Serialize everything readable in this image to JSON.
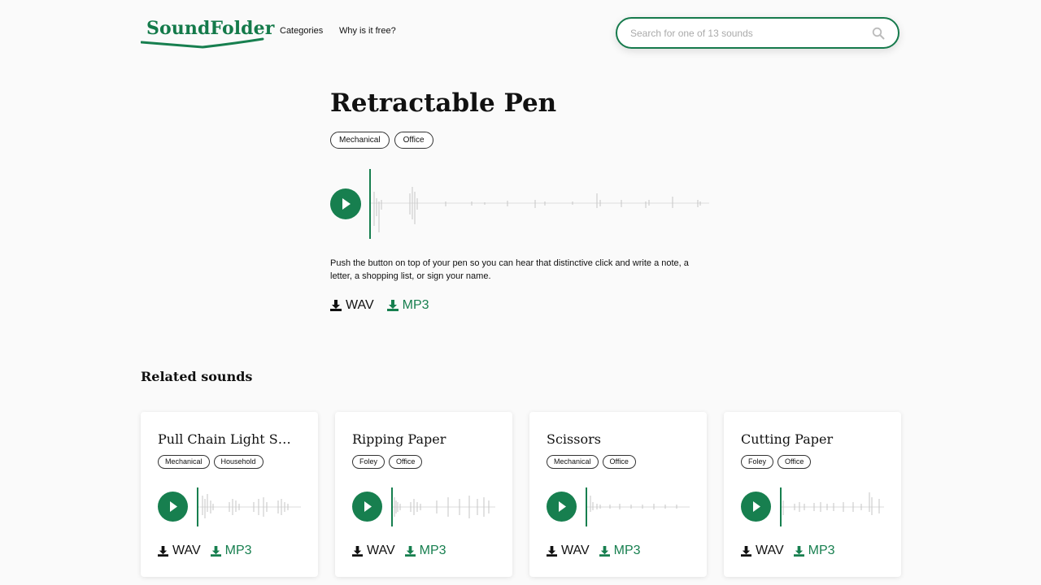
{
  "brand": {
    "name": "SoundFolder",
    "color": "#177f4f"
  },
  "nav": {
    "categories": "Categories",
    "why_free": "Why is it free?"
  },
  "search": {
    "placeholder": "Search for one of 13 sounds",
    "value": "",
    "icon": "search-icon"
  },
  "sound": {
    "title": "Retractable Pen",
    "tags": [
      "Mechanical",
      "Office"
    ],
    "description": "Push the button on top of your pen so you can hear that distinctive click and write a note, a letter, a shopping list, or sign your name.",
    "downloads": {
      "wav": "WAV",
      "mp3": "MP3"
    }
  },
  "related": {
    "heading": "Related sounds",
    "items": [
      {
        "title": "Pull Chain Light Switch",
        "tags": [
          "Mechanical",
          "Household"
        ],
        "wav": "WAV",
        "mp3": "MP3"
      },
      {
        "title": "Ripping Paper",
        "tags": [
          "Foley",
          "Office"
        ],
        "wav": "WAV",
        "mp3": "MP3"
      },
      {
        "title": "Scissors",
        "tags": [
          "Mechanical",
          "Office"
        ],
        "wav": "WAV",
        "mp3": "MP3"
      },
      {
        "title": "Cutting Paper",
        "tags": [
          "Foley",
          "Office"
        ],
        "wav": "WAV",
        "mp3": "MP3"
      }
    ]
  },
  "colors": {
    "accent": "#177f4f",
    "waveform": "#c8c8c8",
    "background": "#fafafa"
  }
}
